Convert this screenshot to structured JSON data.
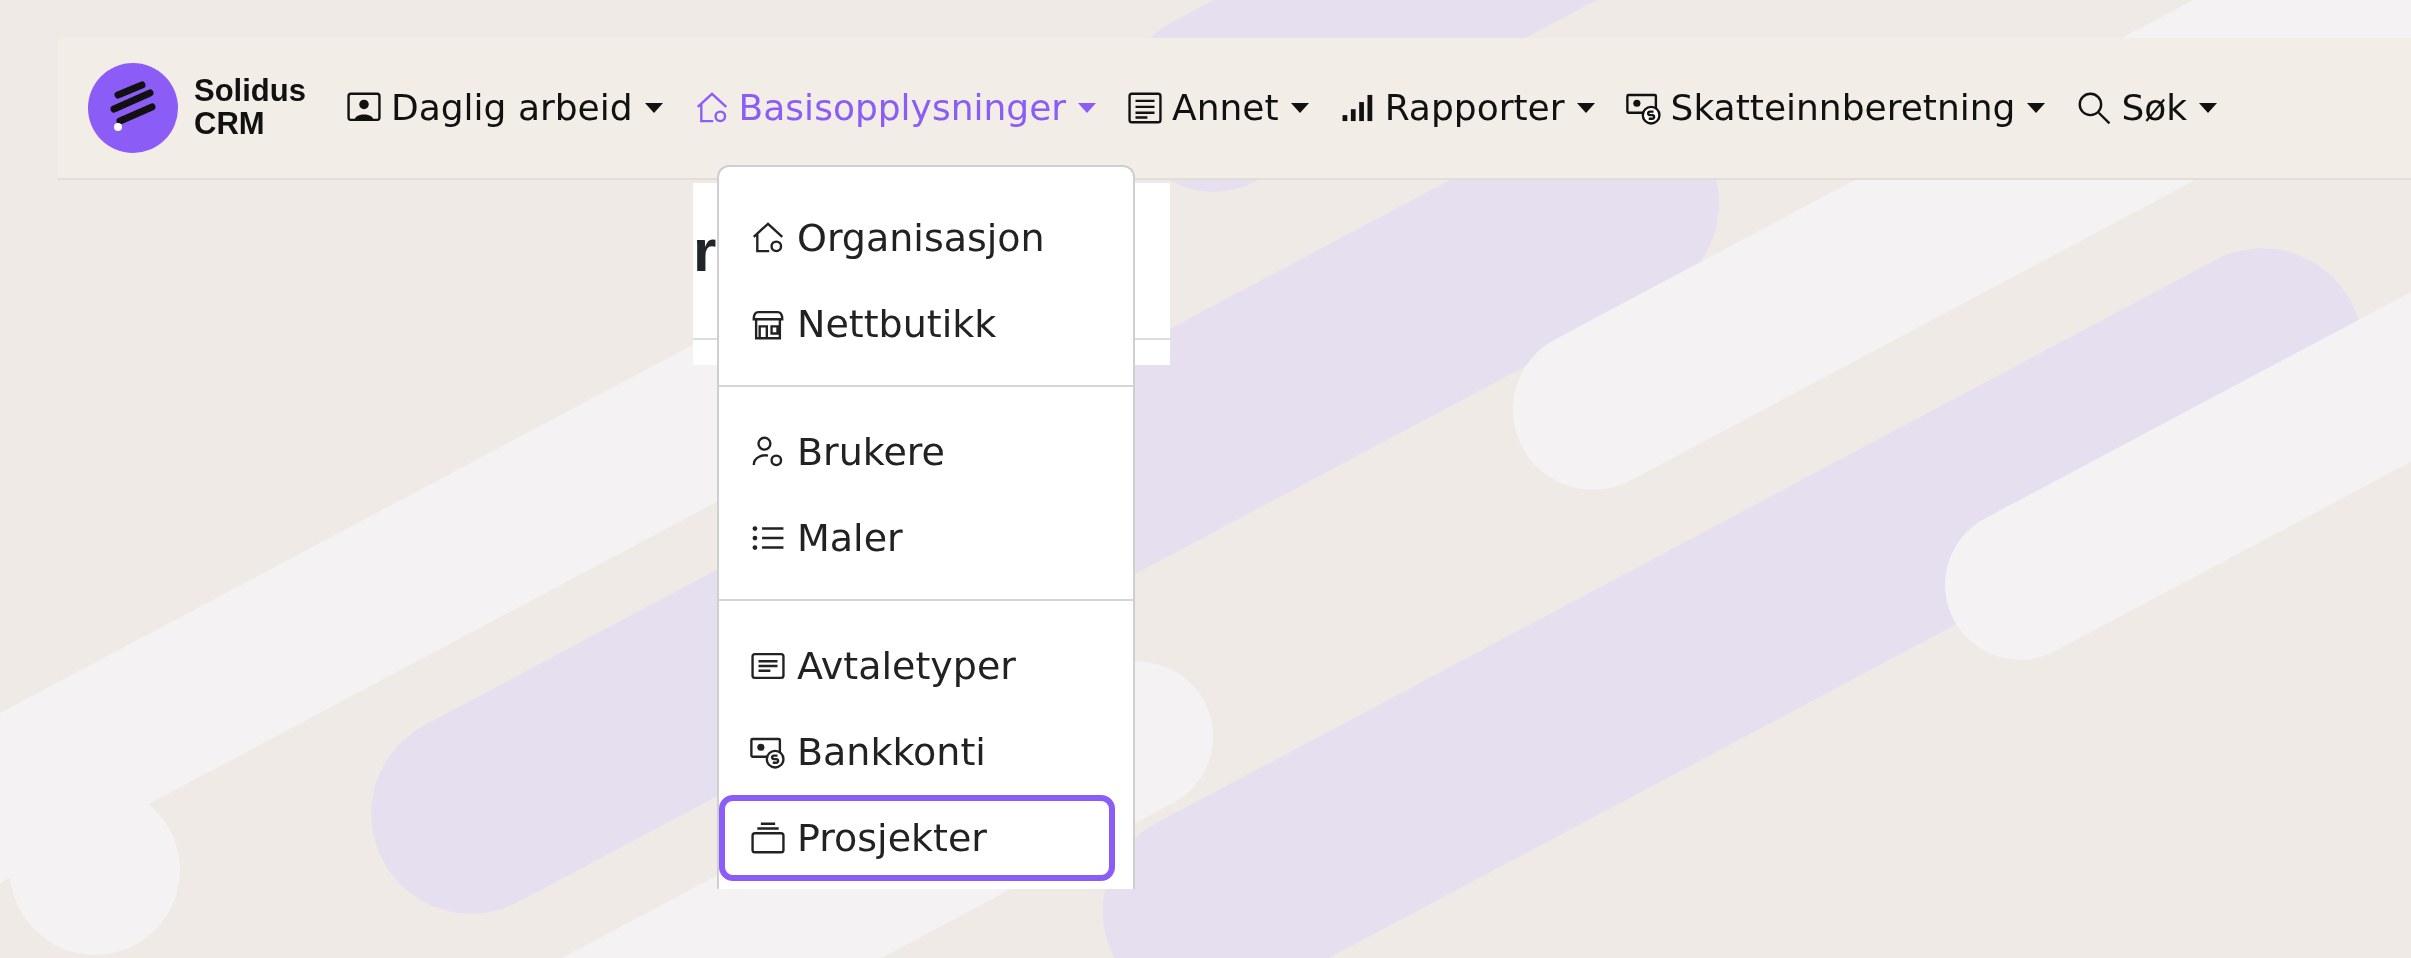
{
  "brand": {
    "name": "Solidus",
    "sub": "CRM"
  },
  "nav": [
    {
      "label": "Daglig arbeid",
      "selected": false
    },
    {
      "label": "Basisopplysninger",
      "selected": true
    },
    {
      "label": "Annet",
      "selected": false
    },
    {
      "label": "Rapporter",
      "selected": false
    },
    {
      "label": "Skatteinnberetning",
      "selected": false
    },
    {
      "label": "Søk",
      "selected": false
    }
  ],
  "heading_fragment": "r",
  "dropdown": {
    "groups": [
      {
        "items": [
          {
            "label": "Organisasjon",
            "selected": false
          },
          {
            "label": "Nettbutikk",
            "selected": false
          }
        ]
      },
      {
        "items": [
          {
            "label": "Brukere",
            "selected": false
          },
          {
            "label": "Maler",
            "selected": false
          }
        ]
      },
      {
        "items": [
          {
            "label": "Avtaletyper",
            "selected": false
          },
          {
            "label": "Bankkonti",
            "selected": false
          },
          {
            "label": "Prosjekter",
            "selected": true
          }
        ]
      }
    ]
  }
}
